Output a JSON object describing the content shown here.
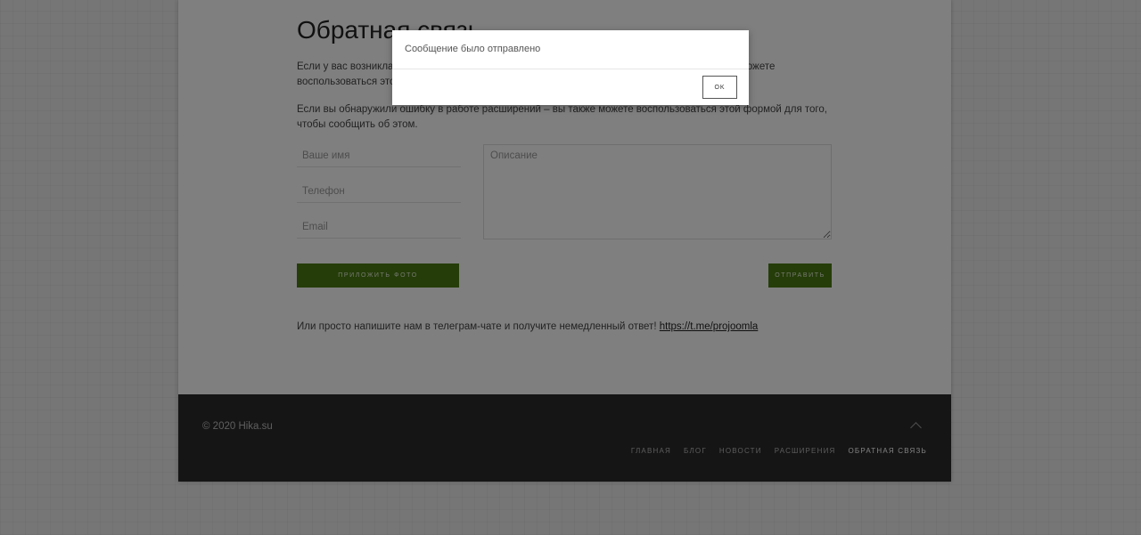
{
  "page": {
    "title": "Обратная связь",
    "intro_visible": "Если у вас возникла",
    "intro_right": "можете",
    "intro_line2": "воспользоваться это",
    "bug_text": "Если вы обнаружили ошибку в работе расширений – вы также можете воспользоваться этой формой для того, чтобы сообщить об этом."
  },
  "form": {
    "name_placeholder": "Ваше имя",
    "phone_placeholder": "Телефон",
    "email_placeholder": "Email",
    "description_placeholder": "Описание",
    "attach_photo_label": "ПРИЛОЖИТЬ ФОТО",
    "send_label": "ОТПРАВИТЬ"
  },
  "telegram": {
    "text": "Или просто напишите нам в телеграм-чате и получите немедленный ответ!",
    "link": "https://t.me/projoomla"
  },
  "footer": {
    "copyright": "© 2020 Hika.su",
    "nav": [
      "ГЛАВНАЯ",
      "БЛОГ",
      "НОВОСТИ",
      "РАСШИРЕНИЯ",
      "ОБРАТНАЯ СВЯЗЬ"
    ],
    "active_nav": "ОБРАТНАЯ СВЯЗЬ"
  },
  "modal": {
    "message": "Сообщение было отправлено",
    "ok_label": "OK"
  },
  "icons": {
    "scroll_top": "chevron-up-icon",
    "resize": "resize-handle-icon"
  },
  "colors": {
    "accent": "#4a7a12",
    "footer_bg": "#2b2b2b",
    "overlay": "rgba(0,0,0,0.5)"
  }
}
